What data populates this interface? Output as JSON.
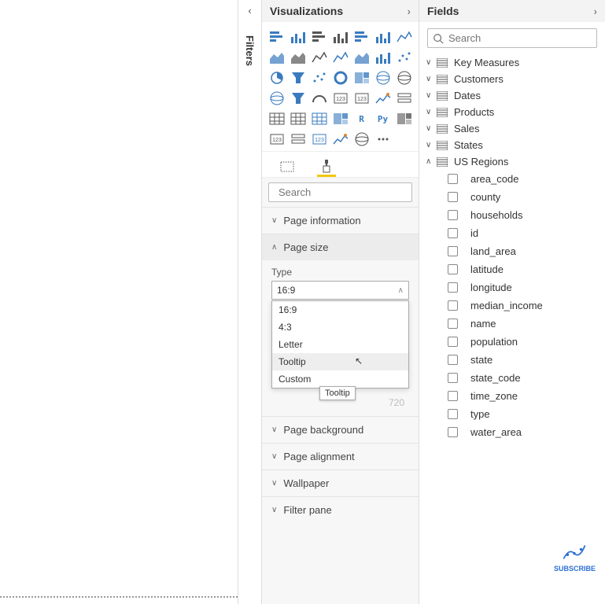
{
  "filters": {
    "label": "Filters"
  },
  "viz": {
    "title": "Visualizations",
    "search_ph": "Search",
    "sections": {
      "page_info": "Page information",
      "page_size": "Page size",
      "page_bg": "Page background",
      "page_align": "Page alignment",
      "wallpaper": "Wallpaper",
      "filter_pane": "Filter pane"
    },
    "type_label": "Type",
    "type_value": "16:9",
    "type_options": [
      "16:9",
      "4:3",
      "Letter",
      "Tooltip",
      "Custom"
    ],
    "type_tooltip": "Tooltip",
    "ghost_h": "720"
  },
  "fields": {
    "title": "Fields",
    "search_ph": "Search",
    "tables": [
      {
        "name": "Key Measures",
        "open": false
      },
      {
        "name": "Customers",
        "open": false
      },
      {
        "name": "Dates",
        "open": false
      },
      {
        "name": "Products",
        "open": false
      },
      {
        "name": "Sales",
        "open": false
      },
      {
        "name": "States",
        "open": false
      },
      {
        "name": "US Regions",
        "open": true,
        "cols": [
          "area_code",
          "county",
          "households",
          "id",
          "land_area",
          "latitude",
          "longitude",
          "median_income",
          "name",
          "population",
          "state",
          "state_code",
          "time_zone",
          "type",
          "water_area"
        ]
      }
    ]
  },
  "subscribe": "SUBSCRIBE"
}
